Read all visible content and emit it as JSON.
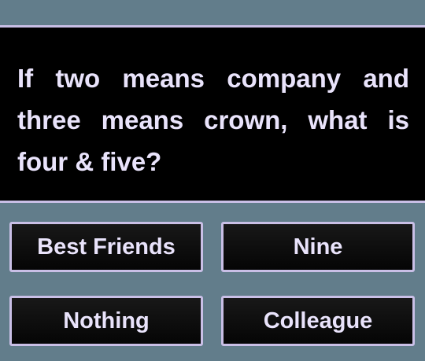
{
  "question": {
    "text": "If two means company and three means crown, what is four & five?"
  },
  "answers": [
    {
      "label": "Best Friends"
    },
    {
      "label": "Nine"
    },
    {
      "label": "Nothing"
    },
    {
      "label": "Colleague"
    }
  ],
  "colors": {
    "background": "#627d8b",
    "panel": "#000000",
    "border": "#c9bfe6",
    "text": "#e9e3fb"
  }
}
